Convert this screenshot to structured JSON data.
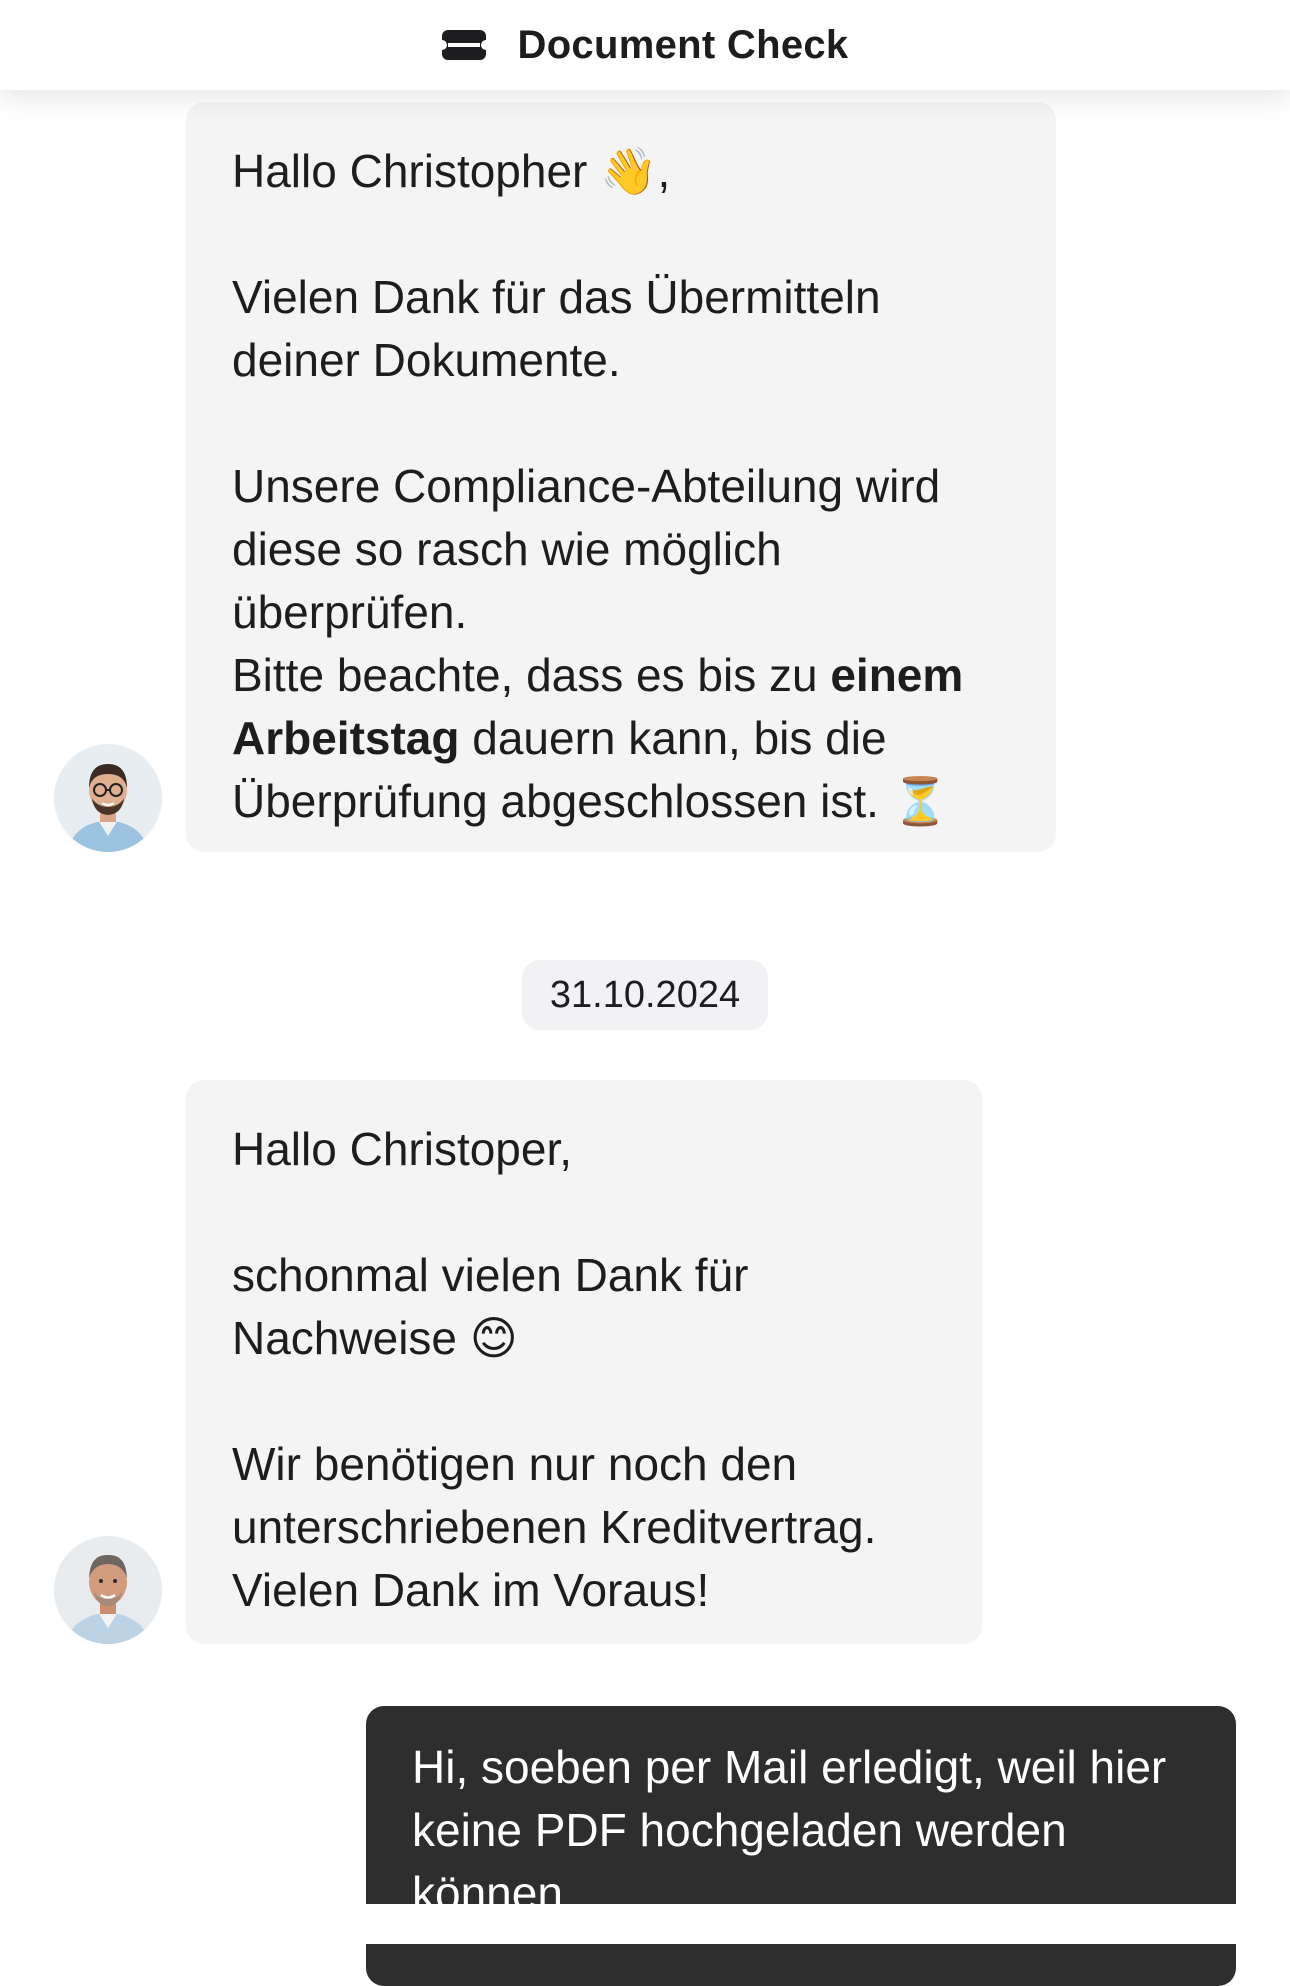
{
  "header": {
    "title": "Document Check",
    "icon": "ticket-icon"
  },
  "messages": [
    {
      "direction": "incoming",
      "avatar": "agent-avatar-glasses",
      "lines": {
        "greeting": "Hallo Christopher",
        "greeting_emoji": "👋",
        "greeting_suffix": ",",
        "p1": "Vielen Dank für das Übermitteln deiner Dokumente.",
        "p2": "Unsere Compliance-Abteilung wird diese so rasch wie möglich überprüfen.",
        "p3_start": "Bitte beachte, dass es bis zu ",
        "p3_bold": "einem Arbeitstag",
        "p3_end": " dauern kann, bis die Überprüfung abgeschlossen ist.",
        "p3_emoji": "⏳"
      }
    },
    {
      "direction": "incoming",
      "avatar": "agent-avatar-gray-hair",
      "lines": {
        "greeting": "Hallo Christoper,",
        "p1": "schonmal vielen Dank für Nachweise",
        "p1_emoji": "😊",
        "p2": "Wir benötigen nur noch den unterschriebenen Kreditvertrag.",
        "p3": "Vielen Dank im Voraus!"
      }
    },
    {
      "direction": "outgoing",
      "text": "Hi, soeben per Mail erledigt, weil hier keine PDF hochgeladen werden können."
    }
  ],
  "date_separator": "31.10.2024",
  "colors": {
    "incoming_bubble": "#f4f4f5",
    "outgoing_bubble": "#2e2e2e",
    "date_chip": "#f2f2f4"
  }
}
